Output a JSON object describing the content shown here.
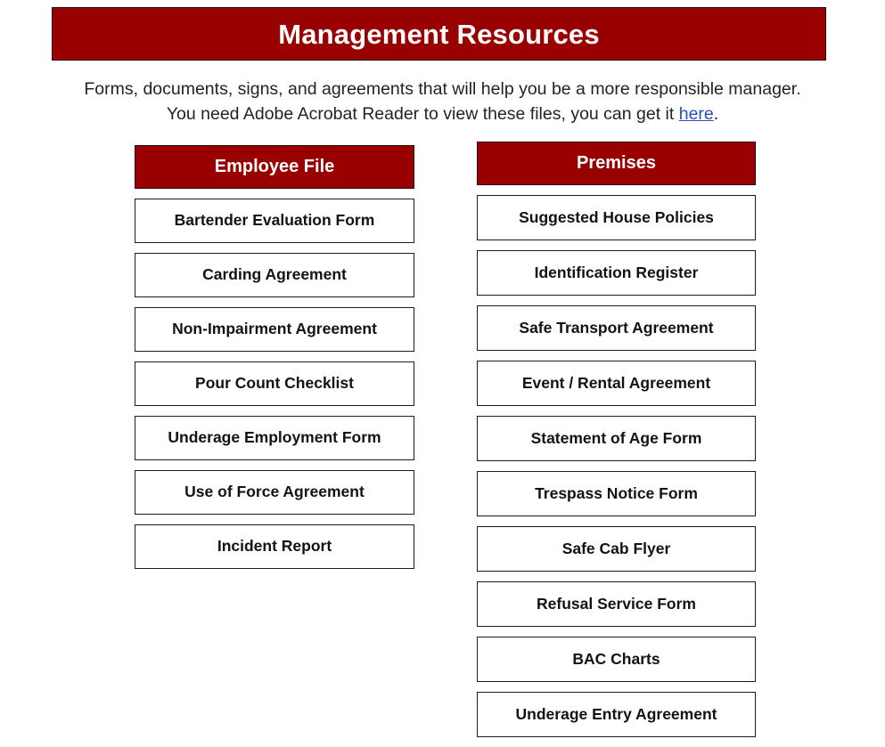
{
  "page": {
    "banner_title": "Management Resources",
    "banner_color": "#990000",
    "link_color": "#2a4fb8"
  },
  "intro": {
    "line1": "Forms, documents, signs, and agreements that will help you be a more responsible manager.",
    "line2_before": "You need Adobe Acrobat Reader to view these files, you can get it ",
    "link_text": "here",
    "line2_after": "."
  },
  "columns": [
    {
      "id": "employee-file",
      "header": "Employee File",
      "items": [
        {
          "label": "Bartender Evaluation Form"
        },
        {
          "label": "Carding Agreement"
        },
        {
          "label": "Non-Impairment Agreement"
        },
        {
          "label": "Pour Count Checklist"
        },
        {
          "label": "Underage Employment Form"
        },
        {
          "label": "Use of Force Agreement"
        },
        {
          "label": "Incident Report"
        }
      ]
    },
    {
      "id": "premises",
      "header": "Premises",
      "items": [
        {
          "label": "Suggested House Policies"
        },
        {
          "label": "Identification Register"
        },
        {
          "label": "Safe Transport Agreement"
        },
        {
          "label": "Event / Rental Agreement"
        },
        {
          "label": "Statement of Age Form"
        },
        {
          "label": "Trespass Notice Form"
        },
        {
          "label": "Safe Cab Flyer"
        },
        {
          "label": "Refusal Service Form"
        },
        {
          "label": "BAC Charts"
        },
        {
          "label": "Underage Entry Agreement"
        }
      ]
    }
  ]
}
